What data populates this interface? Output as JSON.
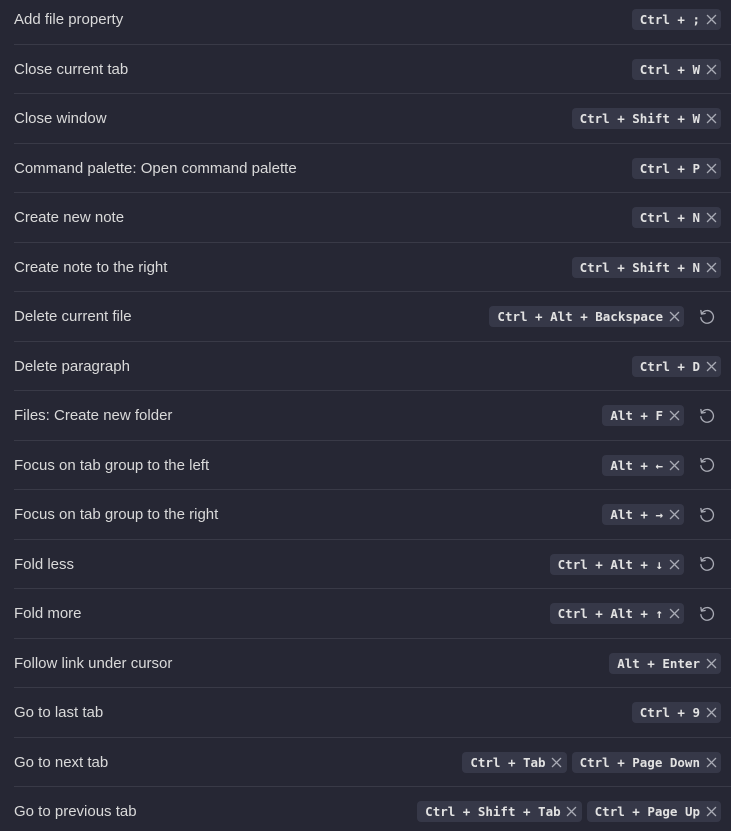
{
  "colors": {
    "background": "#262734",
    "divider": "#393a47",
    "hotkey_bg": "#363848",
    "text": "#dadada",
    "icon": "#a9abb5"
  },
  "commands": [
    {
      "label": "Add file property",
      "hotkeys": [
        "Ctrl + ;"
      ],
      "resettable": false
    },
    {
      "label": "Close current tab",
      "hotkeys": [
        "Ctrl + W"
      ],
      "resettable": false
    },
    {
      "label": "Close window",
      "hotkeys": [
        "Ctrl + Shift + W"
      ],
      "resettable": false
    },
    {
      "label": "Command palette: Open command palette",
      "hotkeys": [
        "Ctrl + P"
      ],
      "resettable": false
    },
    {
      "label": "Create new note",
      "hotkeys": [
        "Ctrl + N"
      ],
      "resettable": false
    },
    {
      "label": "Create note to the right",
      "hotkeys": [
        "Ctrl + Shift + N"
      ],
      "resettable": false
    },
    {
      "label": "Delete current file",
      "hotkeys": [
        "Ctrl + Alt + Backspace"
      ],
      "resettable": true
    },
    {
      "label": "Delete paragraph",
      "hotkeys": [
        "Ctrl + D"
      ],
      "resettable": false
    },
    {
      "label": "Files: Create new folder",
      "hotkeys": [
        "Alt + F"
      ],
      "resettable": true
    },
    {
      "label": "Focus on tab group to the left",
      "hotkeys": [
        "Alt + ←"
      ],
      "resettable": true
    },
    {
      "label": "Focus on tab group to the right",
      "hotkeys": [
        "Alt + →"
      ],
      "resettable": true
    },
    {
      "label": "Fold less",
      "hotkeys": [
        "Ctrl + Alt + ↓"
      ],
      "resettable": true
    },
    {
      "label": "Fold more",
      "hotkeys": [
        "Ctrl + Alt + ↑"
      ],
      "resettable": true
    },
    {
      "label": "Follow link under cursor",
      "hotkeys": [
        "Alt + Enter"
      ],
      "resettable": false
    },
    {
      "label": "Go to last tab",
      "hotkeys": [
        "Ctrl + 9"
      ],
      "resettable": false
    },
    {
      "label": "Go to next tab",
      "hotkeys": [
        "Ctrl + Tab",
        "Ctrl + Page Down"
      ],
      "resettable": false
    },
    {
      "label": "Go to previous tab",
      "hotkeys": [
        "Ctrl + Shift + Tab",
        "Ctrl + Page Up"
      ],
      "resettable": false
    }
  ]
}
